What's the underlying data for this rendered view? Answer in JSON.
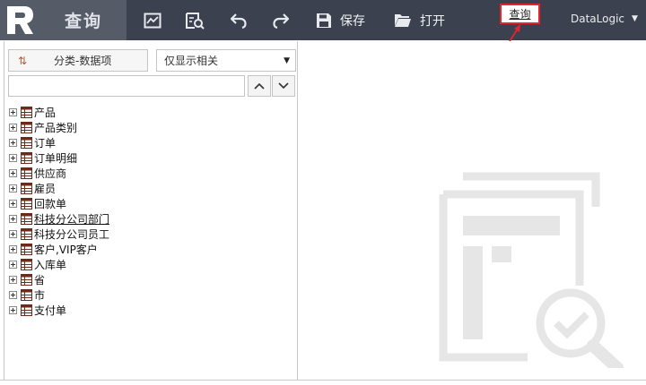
{
  "toolbar": {
    "app_title": "查询",
    "buttons": [
      {
        "icon": "chart-image-icon"
      },
      {
        "icon": "search-report-icon"
      },
      {
        "icon": "undo-icon"
      },
      {
        "icon": "redo-icon"
      },
      {
        "icon": "save-icon",
        "label": "保存"
      },
      {
        "icon": "folder-open-icon",
        "label": "打开"
      }
    ],
    "query_button": "查询",
    "user": "DataLogic",
    "accent_color": "#e2262b",
    "bar_color": "#3c4150"
  },
  "left_panel": {
    "sort_button": "分类-数据项",
    "filter_select": "仅显示相关",
    "search_value": "",
    "tree": [
      {
        "label": "产品"
      },
      {
        "label": "产品类别"
      },
      {
        "label": "订单"
      },
      {
        "label": "订单明细"
      },
      {
        "label": "供应商"
      },
      {
        "label": "雇员"
      },
      {
        "label": "回款单"
      },
      {
        "label": "科技分公司部门",
        "underlined": true
      },
      {
        "label": "科技分公司员工"
      },
      {
        "label": "客户,VIP客户"
      },
      {
        "label": "入库单"
      },
      {
        "label": "省"
      },
      {
        "label": "市"
      },
      {
        "label": "支付单"
      }
    ]
  }
}
